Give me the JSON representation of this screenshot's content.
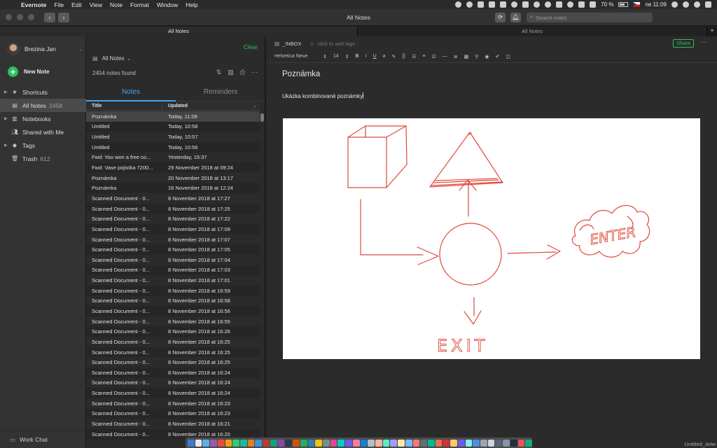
{
  "menubar": {
    "app": "Evernote",
    "items": [
      "File",
      "Edit",
      "View",
      "Note",
      "Format",
      "Window",
      "Help"
    ],
    "battery": "70 %",
    "clock": "ne 11:09"
  },
  "window": {
    "title": "All Notes",
    "search_placeholder": "Search notes"
  },
  "tabs": [
    "All Notes",
    "All Notes"
  ],
  "sidebar": {
    "user": "Brezina Jan",
    "new_note": "New Note",
    "items": [
      {
        "label": "Shortcuts",
        "count": "",
        "icon": "star-icon",
        "expand": true
      },
      {
        "label": "All Notes",
        "count": "2458",
        "icon": "note-icon",
        "expand": false
      },
      {
        "label": "Notebooks",
        "count": "",
        "icon": "notebook-icon",
        "expand": true
      },
      {
        "label": "Shared with Me",
        "count": "",
        "icon": "people-icon",
        "expand": false
      },
      {
        "label": "Tags",
        "count": "",
        "icon": "tag-icon",
        "expand": true
      },
      {
        "label": "Trash",
        "count": "612",
        "icon": "trash-icon",
        "expand": false
      }
    ],
    "work_chat": "Work Chat"
  },
  "notelist": {
    "clear": "Clear",
    "notebook_select": "All Notes",
    "found": "2454 notes found",
    "tabs": [
      "Notes",
      "Reminders"
    ],
    "columns": [
      "Title",
      "Updated"
    ],
    "rows": [
      {
        "title": "Poznámka",
        "updated": "Today, 11:09"
      },
      {
        "title": "Untitled",
        "updated": "Today, 10:58"
      },
      {
        "title": "Untitled",
        "updated": "Today, 10:57"
      },
      {
        "title": "Untitled",
        "updated": "Today, 10:56"
      },
      {
        "title": "Fwd: You won a free co...",
        "updated": "Yesterday, 15:37"
      },
      {
        "title": "Fwd: Vase pojistka 7200...",
        "updated": "29 November 2018 at 09:24"
      },
      {
        "title": "Poznámka",
        "updated": "20 November 2018 at 13:17"
      },
      {
        "title": "Poznámka",
        "updated": "16 November 2018 at 12:24"
      },
      {
        "title": "Scanned Document - 0...",
        "updated": "8 November 2018 at 17:27"
      },
      {
        "title": "Scanned Document - 0...",
        "updated": "8 November 2018 at 17:25"
      },
      {
        "title": "Scanned Document - 0...",
        "updated": "8 November 2018 at 17:22"
      },
      {
        "title": "Scanned Document - 0...",
        "updated": "8 November 2018 at 17:09"
      },
      {
        "title": "Scanned Document - 0...",
        "updated": "8 November 2018 at 17:07"
      },
      {
        "title": "Scanned Document - 0...",
        "updated": "8 November 2018 at 17:05"
      },
      {
        "title": "Scanned Document - 0...",
        "updated": "8 November 2018 at 17:04"
      },
      {
        "title": "Scanned Document - 0...",
        "updated": "8 November 2018 at 17:03"
      },
      {
        "title": "Scanned Document - 0...",
        "updated": "8 November 2018 at 17:01"
      },
      {
        "title": "Scanned Document - 0...",
        "updated": "8 November 2018 at 16:59"
      },
      {
        "title": "Scanned Document - 0...",
        "updated": "8 November 2018 at 16:58"
      },
      {
        "title": "Scanned Document - 0...",
        "updated": "8 November 2018 at 16:56"
      },
      {
        "title": "Scanned Document - 0...",
        "updated": "8 November 2018 at 16:55"
      },
      {
        "title": "Scanned Document - 0...",
        "updated": "8 November 2018 at 16:26"
      },
      {
        "title": "Scanned Document - 0...",
        "updated": "8 November 2018 at 16:25"
      },
      {
        "title": "Scanned Document - 0...",
        "updated": "8 November 2018 at 16:25"
      },
      {
        "title": "Scanned Document - 0...",
        "updated": "8 November 2018 at 16:25"
      },
      {
        "title": "Scanned Document - 0...",
        "updated": "8 November 2018 at 16:24"
      },
      {
        "title": "Scanned Document - 0...",
        "updated": "8 November 2018 at 16:24"
      },
      {
        "title": "Scanned Document - 0...",
        "updated": "8 November 2018 at 16:24"
      },
      {
        "title": "Scanned Document - 0...",
        "updated": "8 November 2018 at 16:23"
      },
      {
        "title": "Scanned Document - 0...",
        "updated": "8 November 2018 at 16:23"
      },
      {
        "title": "Scanned Document - 0...",
        "updated": "8 November 2018 at 16:21"
      },
      {
        "title": "Scanned Document - 0...",
        "updated": "8 November 2018 at 16:20"
      }
    ]
  },
  "editor": {
    "notebook": "_INBOX",
    "tag_placeholder": "click to add tags",
    "share": "Share",
    "font": "Helvetica Neue",
    "size": "14",
    "title": "Poznámka",
    "body": "Ukázka kombinované poznámky",
    "sketch_labels": [
      "ENTER",
      "EXIT"
    ],
    "sketch_color": "#e0483a"
  },
  "desktop": {
    "file": "Untitled_Artw"
  },
  "colors": {
    "accent_green": "#2dbe60",
    "accent_blue": "#46a4f5"
  }
}
